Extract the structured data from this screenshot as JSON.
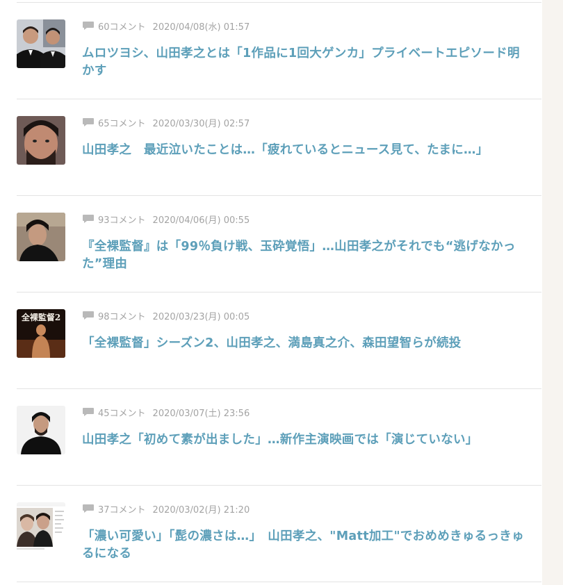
{
  "articles": [
    {
      "comments": "60コメント",
      "date": "2020/04/08(水) 01:57",
      "title": "ムロツヨシ、山田孝之とは「1作品に1回大ゲンカ」プライベートエピソード明かす",
      "thumbnail": "two-men-in-suits-photo"
    },
    {
      "comments": "65コメント",
      "date": "2020/03/30(月) 02:57",
      "title": "山田孝之　最近泣いたことは…「疲れているとニュース見て、たまに…」",
      "thumbnail": "bearded-man-portrait"
    },
    {
      "comments": "93コメント",
      "date": "2020/04/06(月) 00:55",
      "title": "『全裸監督』は「99％負け戦、玉砕覚悟」…山田孝之がそれでも“逃げなかった”理由",
      "thumbnail": "man-in-black-portrait"
    },
    {
      "comments": "98コメント",
      "date": "2020/03/23(月) 00:05",
      "title": "「全裸監督」シーズン2、山田孝之、満島真之介、森田望智らが続投",
      "thumbnail": "series-poster",
      "poster_text": "全裸監督2"
    },
    {
      "comments": "45コメント",
      "date": "2020/03/07(土) 23:56",
      "title": "山田孝之「初めて素が出ました」…新作主演映画では「演じていない」",
      "thumbnail": "man-in-black-suit-photo"
    },
    {
      "comments": "37コメント",
      "date": "2020/03/02(月) 21:20",
      "title": "「濃い可愛い」「髭の濃さは…」　山田孝之、\"Matt加工\"でおめめきゅるっきゅるになる",
      "thumbnail": "social-post-screenshot"
    }
  ],
  "colors": {
    "title": "#5d9fb9",
    "meta": "#a3a3a3",
    "divider": "#e3e3e3",
    "gutter": "#f7f4f0"
  }
}
